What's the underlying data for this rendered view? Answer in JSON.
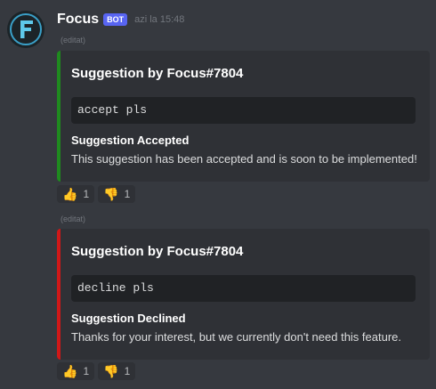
{
  "message": {
    "author": "Focus",
    "bot_tag": "BOT",
    "timestamp": "azi la 15:48"
  },
  "embeds": [
    {
      "edited": "(editat)",
      "accent_color": "#1f8a1f",
      "title": "Suggestion by Focus#7804",
      "code": "accept pls",
      "field_name": "Suggestion Accepted",
      "field_value": "This suggestion has been accepted and is soon to be implemented!",
      "reactions": [
        {
          "icon": "thumbs-up-icon",
          "emoji": "👍",
          "count": "1"
        },
        {
          "icon": "thumbs-down-icon",
          "emoji": "👎",
          "count": "1"
        }
      ]
    },
    {
      "edited": "(editat)",
      "accent_color": "#d01818",
      "title": "Suggestion by Focus#7804",
      "code": "decline pls",
      "field_name": "Suggestion Declined",
      "field_value": "Thanks for your interest, but we currently don't need this feature.",
      "reactions": [
        {
          "icon": "thumbs-up-icon",
          "emoji": "👍",
          "count": "1"
        },
        {
          "icon": "thumbs-down-icon",
          "emoji": "👎",
          "count": "1"
        }
      ]
    }
  ]
}
